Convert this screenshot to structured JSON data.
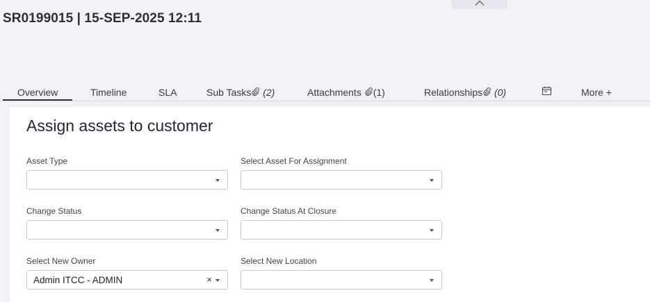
{
  "header": {
    "title": "SR0199015 | 15-SEP-2025 12:11"
  },
  "tabs": [
    {
      "label": "Overview"
    },
    {
      "label": "Timeline"
    },
    {
      "label": "SLA"
    },
    {
      "label": "Sub Tasks",
      "count": "(2)"
    },
    {
      "label": "Attachments",
      "count": "(1)"
    },
    {
      "label": "Relationships",
      "count": "(0)"
    },
    {
      "icon": "calendar-icon"
    },
    {
      "label": "More +"
    }
  ],
  "panel": {
    "title": "Assign assets to customer",
    "fields": {
      "asset_type": {
        "label": "Asset Type",
        "value": ""
      },
      "select_asset": {
        "label": "Select Asset For Assignment",
        "value": ""
      },
      "change_status": {
        "label": "Change Status",
        "value": ""
      },
      "change_status_closure": {
        "label": "Change Status At Closure",
        "value": ""
      },
      "new_owner": {
        "label": "Select New Owner",
        "value": "Admin ITCC - ADMIN",
        "clear": "×"
      },
      "new_location": {
        "label": "Select New Location",
        "value": ""
      }
    }
  }
}
